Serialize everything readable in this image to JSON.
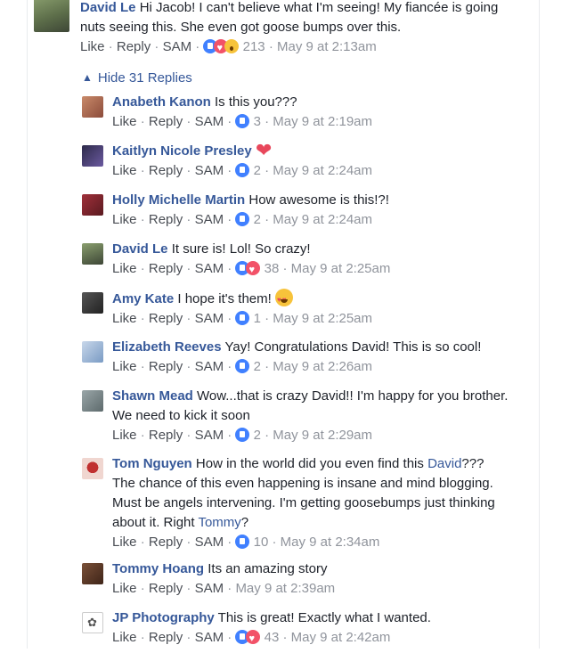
{
  "main_comment": {
    "author": "David Le",
    "text_line1": "Hi Jacob! I can't believe what I'm seeing! My fiancée is going",
    "text_line2": "nuts seeing this. She even got goose bumps over this.",
    "actions": [
      "Like",
      "Reply",
      "SAM"
    ],
    "reactions": [
      "like",
      "love",
      "wow"
    ],
    "reaction_count": "213",
    "timestamp": "May 9 at 2:13am"
  },
  "hide_replies_label": "Hide 31 Replies",
  "replies": [
    {
      "author": "Anabeth Kanon",
      "text": "Is this you???",
      "reactions": [
        "like"
      ],
      "count": "3",
      "time": "May 9 at 2:19am"
    },
    {
      "author": "Kaitlyn Nicole Presley",
      "text": "",
      "emoji": "heart",
      "reactions": [
        "like"
      ],
      "count": "2",
      "time": "May 9 at 2:24am"
    },
    {
      "author": "Holly Michelle Martin",
      "text": "How awesome is this!?!",
      "reactions": [
        "like"
      ],
      "count": "2",
      "time": "May 9 at 2:24am"
    },
    {
      "author": "David Le",
      "text": "It sure is! Lol! So crazy!",
      "reactions": [
        "like",
        "love"
      ],
      "count": "38",
      "time": "May 9 at 2:25am"
    },
    {
      "author": "Amy Kate",
      "text": "I hope it's them!",
      "emoji": "heart-eyes",
      "reactions": [
        "like"
      ],
      "count": "1",
      "time": "May 9 at 2:25am"
    },
    {
      "author": "Elizabeth Reeves",
      "text": "Yay! Congratulations David! This is so cool!",
      "reactions": [
        "like"
      ],
      "count": "2",
      "time": "May 9 at 2:26am"
    },
    {
      "author": "Shawn Mead",
      "text": "Wow...that is crazy David!! I'm happy for you brother.",
      "text2": "We need to kick it soon",
      "reactions": [
        "like"
      ],
      "count": "2",
      "time": "May 9 at 2:29am"
    },
    {
      "author": "Tom Nguyen",
      "text": "How in the world did you even find this ",
      "mention": "David",
      "text_after_mention": "???",
      "text2": "The chance of this even happening is insane and mind blogging.",
      "text3": "Must be angels intervening. I'm getting goosebumps just thinking",
      "text4_before": "about it. Right ",
      "mention2": "Tommy",
      "text4_after": "?",
      "reactions": [
        "like"
      ],
      "count": "10",
      "time": "May 9 at 2:34am"
    },
    {
      "author": "Tommy Hoang",
      "text": "Its an amazing story",
      "reactions": [],
      "count": "",
      "time": "May 9 at 2:39am"
    },
    {
      "author": "JP Photography",
      "text": "This is great! Exactly what I wanted.",
      "reactions": [
        "like",
        "love"
      ],
      "count": "43",
      "time": "May 9 at 2:42am"
    }
  ],
  "colors": {
    "link": "#365899",
    "meta": "#90949c",
    "like": "#4080ff",
    "love": "#f25268",
    "wow": "#f7c33b"
  }
}
